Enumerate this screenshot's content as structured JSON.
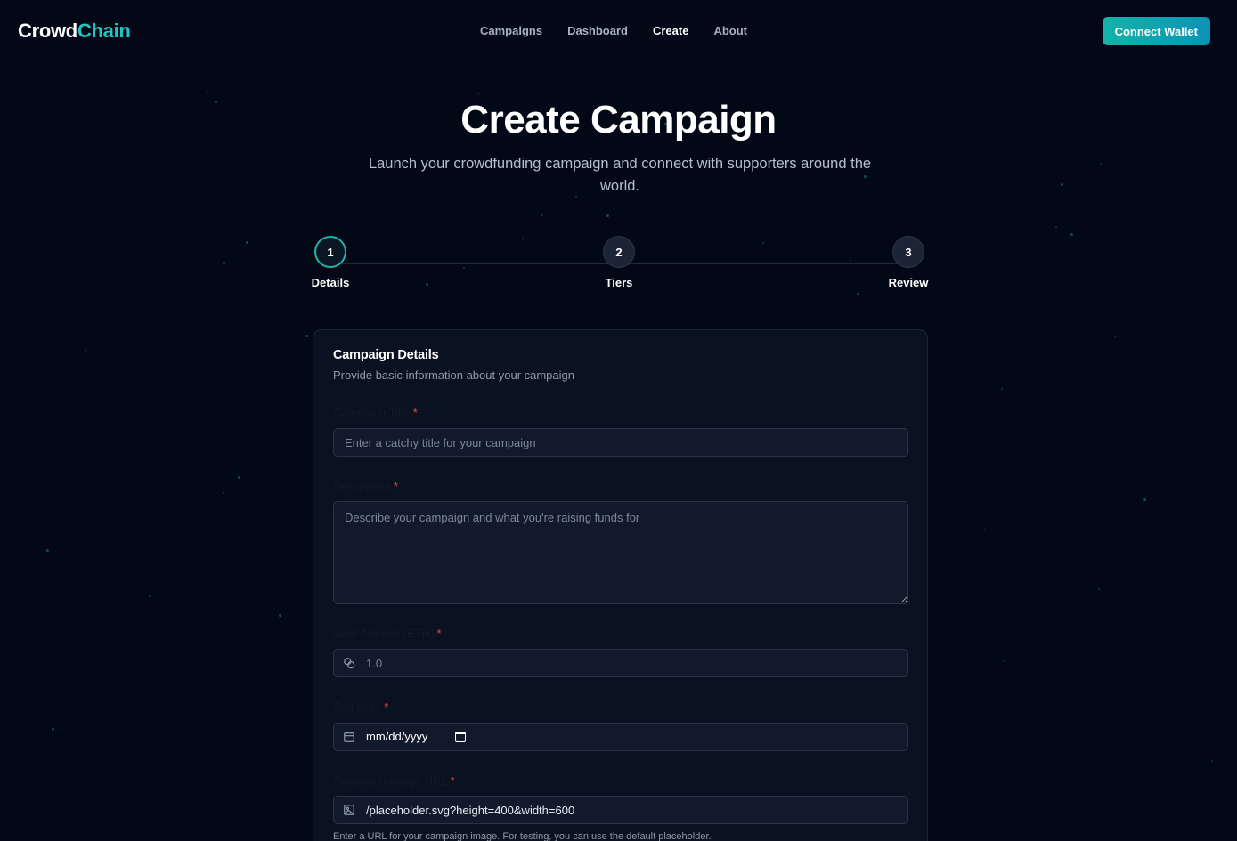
{
  "header": {
    "logo_part1": "Crowd",
    "logo_part2": "Chain",
    "nav": [
      "Campaigns",
      "Dashboard",
      "Create",
      "About"
    ],
    "active_nav": "Create",
    "connect_label": "Connect Wallet"
  },
  "hero": {
    "title": "Create Campaign",
    "subtitle": "Launch your crowdfunding campaign and connect with supporters around the world."
  },
  "stepper": {
    "current_step": 1,
    "steps": [
      {
        "number": "1",
        "label": "Details"
      },
      {
        "number": "2",
        "label": "Tiers"
      },
      {
        "number": "3",
        "label": "Review"
      }
    ]
  },
  "form": {
    "title": "Campaign Details",
    "subtitle": "Provide basic information about your campaign",
    "required_mark": "*",
    "fields": {
      "title": {
        "label": "Campaign Title",
        "placeholder": "Enter a catchy title for your campaign",
        "value": ""
      },
      "description": {
        "label": "Description",
        "placeholder": "Describe your campaign and what you're raising funds for",
        "value": ""
      },
      "goal": {
        "label": "Goal Amount (ETH)",
        "placeholder": "1.0",
        "value": "",
        "icon": "coins-icon"
      },
      "end_date": {
        "label": "End Date",
        "value": "mm/dd/yyyy",
        "icon": "calendar-icon"
      },
      "image_url": {
        "label": "Campaign Image URL",
        "value": "/placeholder.svg?height=400&width=600",
        "icon": "image-icon",
        "helper": "Enter a URL for your campaign image. For testing, you can use the default placeholder."
      }
    }
  },
  "colors": {
    "background": "#030817",
    "accent": "#22c6c0",
    "button_gradient_start": "#13b3a8",
    "button_gradient_end": "#0b93b7",
    "required": "#e5484d"
  }
}
